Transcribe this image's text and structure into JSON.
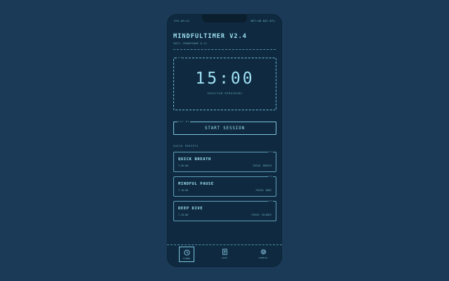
{
  "status_bar": {
    "left": "SYS-09:41",
    "right": "NET:ON BAT:87%"
  },
  "app": {
    "title": "MINDFULTIMER V2.4",
    "subtitle": "INIT: MINDFRAME 0.11"
  },
  "timer": {
    "tag": "T-0",
    "value": "15:00",
    "label": "DURATION REMAINING"
  },
  "start_button": {
    "tag": "ACT-01",
    "label": "START SESSION"
  },
  "presets": {
    "heading": "QUICK PRESETS",
    "items": [
      {
        "tag": "P-1",
        "name": "QUICK BREATH",
        "time": "T-05:00",
        "focus": "FOCUS: BREATH"
      },
      {
        "tag": "P-2",
        "name": "MINDFUL PAUSE",
        "time": "T-10:00",
        "focus": "FOCUS: BODY"
      },
      {
        "tag": "P-3",
        "name": "DEEP DIVE",
        "time": "T-20:00",
        "focus": "FOCUS: SILENCE"
      }
    ]
  },
  "nav": {
    "items": [
      {
        "label": "TIMER",
        "icon": "clock-icon",
        "active": true
      },
      {
        "label": "LOGS",
        "icon": "document-icon",
        "active": false
      },
      {
        "label": "CONFIG",
        "icon": "gear-icon",
        "active": false
      }
    ]
  },
  "colors": {
    "background": "#1a3a57",
    "phone": "#0f2a40",
    "accent": "#9fe0f4"
  }
}
